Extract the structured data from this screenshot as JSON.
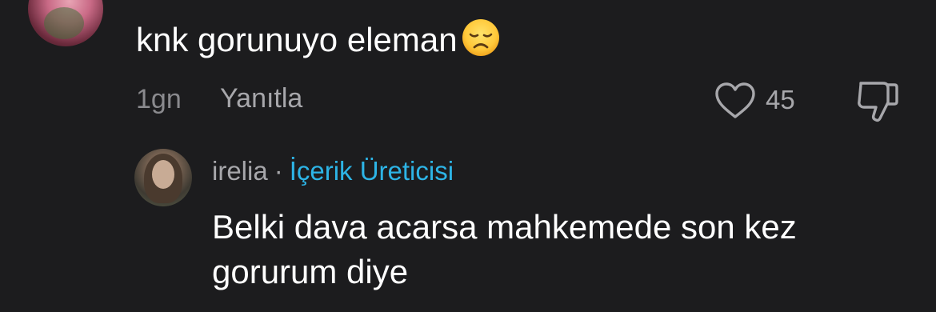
{
  "comment": {
    "text": "knk gorunuyo eleman",
    "emoji": "disappointed-face-emoji",
    "time": "1gn",
    "reply_label": "Yanıtla",
    "like_count": "45"
  },
  "reply": {
    "username": "irelia",
    "separator": "·",
    "badge": "İçerik Üreticisi",
    "text": "Belki dava acarsa mahkemede son kez gorurum diye"
  },
  "colors": {
    "background": "#1c1c1e",
    "primary_text": "#ffffff",
    "secondary_text": "#a7a7ab",
    "creator_badge": "#2db4e6"
  },
  "icons": {
    "like": "heart-outline-icon",
    "dislike": "thumbs-down-outline-icon"
  }
}
